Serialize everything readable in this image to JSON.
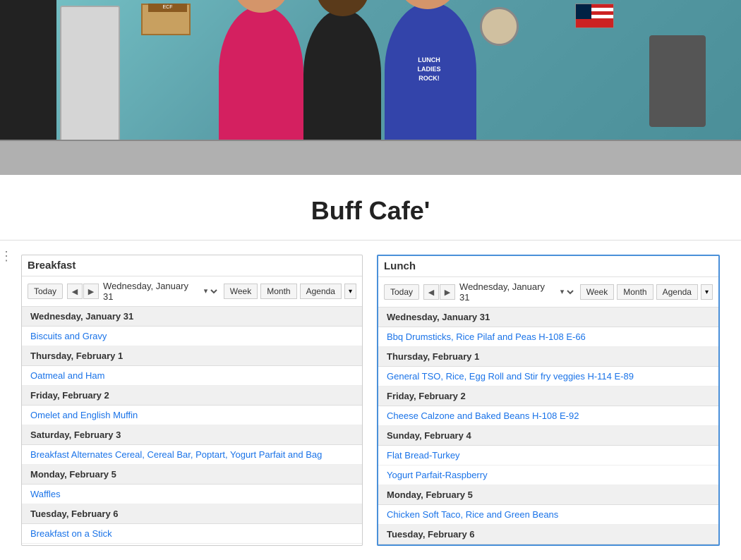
{
  "title": "Buff Cafe'",
  "breakfast": {
    "label": "Breakfast",
    "toolbar": {
      "today": "Today",
      "date": "Wednesday, January 31",
      "week": "Week",
      "month": "Month",
      "agenda": "Agenda"
    },
    "events": [
      {
        "date": "Wednesday, January 31",
        "item": "Biscuits and Gravy"
      },
      {
        "date": "Thursday, February 1",
        "item": "Oatmeal and Ham"
      },
      {
        "date": "Friday, February 2",
        "item": "Omelet and English Muffin"
      },
      {
        "date": "Saturday, February 3",
        "item": "Breakfast Alternates Cereal, Cereal Bar, Poptart, Yogurt Parfait and Bag"
      },
      {
        "date": "Monday, February 5",
        "item": "Waffles"
      },
      {
        "date": "Tuesday, February 6",
        "item": "Breakfast on a Stick"
      }
    ]
  },
  "lunch": {
    "label": "Lunch",
    "toolbar": {
      "today": "Today",
      "date": "Wednesday, January 31",
      "week": "Week",
      "month": "Month",
      "agenda": "Agenda"
    },
    "events": [
      {
        "date": "Wednesday, January 31",
        "item": "Bbq Drumsticks, Rice Pilaf and Peas H-108 E-66"
      },
      {
        "date": "Thursday, February 1",
        "item": "General TSO, Rice, Egg Roll and Stir fry veggies H-114 E-89"
      },
      {
        "date": "Friday, February 2",
        "item": "Cheese Calzone and Baked Beans H-108 E-92"
      },
      {
        "date": "Sunday, February 4",
        "item": "Flat Bread-Turkey"
      },
      {
        "date": "Sunday, February 4",
        "item": "Yogurt Parfait-Raspberry"
      },
      {
        "date": "Monday, February 5",
        "item": "Chicken Soft Taco, Rice and Green Beans"
      },
      {
        "date": "Tuesday, February 6",
        "item": ""
      }
    ]
  }
}
